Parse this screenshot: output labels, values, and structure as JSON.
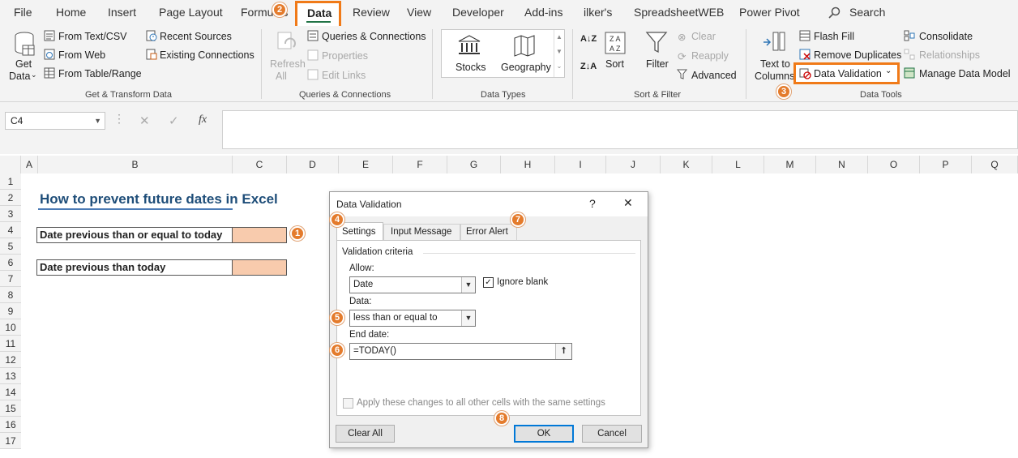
{
  "menu": {
    "tabs": [
      "File",
      "Home",
      "Insert",
      "Page Layout",
      "Formulas",
      "Data",
      "Review",
      "View",
      "Developer",
      "Add-ins",
      "ilker's",
      "SpreadsheetWEB",
      "Power Pivot"
    ],
    "search": "Search"
  },
  "ribbon": {
    "get_data": [
      "Get",
      "Data"
    ],
    "from_text": "From Text/CSV",
    "from_web": "From Web",
    "from_table": "From Table/Range",
    "recent_sources": "Recent Sources",
    "existing_conn": "Existing Connections",
    "group_get": "Get & Transform Data",
    "refresh": [
      "Refresh",
      "All"
    ],
    "queries": "Queries & Connections",
    "properties": "Properties",
    "edit_links": "Edit Links",
    "group_queries": "Queries & Connections",
    "stocks": "Stocks",
    "geography": "Geography",
    "group_types": "Data Types",
    "sort": "Sort",
    "filter": "Filter",
    "clear": "Clear",
    "reapply": "Reapply",
    "advanced": "Advanced",
    "group_sort": "Sort & Filter",
    "text_to_columns": [
      "Text to",
      "Columns"
    ],
    "flash_fill": "Flash Fill",
    "remove_dup": "Remove Duplicates",
    "data_validation": "Data Validation",
    "consolidate": "Consolidate",
    "relationships": "Relationships",
    "manage_model": "Manage Data Model",
    "group_tools": "Data Tools"
  },
  "formula_bar": {
    "name_box": "C4",
    "fx": "fx"
  },
  "columns": [
    "A",
    "B",
    "C",
    "D",
    "E",
    "F",
    "G",
    "H",
    "I",
    "J",
    "K",
    "L",
    "M",
    "N",
    "O",
    "P",
    "Q"
  ],
  "rows": [
    "1",
    "2",
    "3",
    "4",
    "5",
    "6",
    "7",
    "8",
    "9",
    "10",
    "11",
    "12",
    "13",
    "14",
    "15",
    "16",
    "17"
  ],
  "sheet": {
    "title": "How to prevent future dates in Excel",
    "label1": "Date previous than or equal to today",
    "label2": "Date previous than today"
  },
  "dialog": {
    "title": "Data Validation",
    "help": "?",
    "close": "✕",
    "tabs": [
      "Settings",
      "Input Message",
      "Error Alert"
    ],
    "criteria": "Validation criteria",
    "allow_label": "Allow:",
    "allow_value": "Date",
    "ignore_blank": "Ignore blank",
    "data_label": "Data:",
    "data_value": "less than or equal to",
    "end_label": "End date:",
    "end_value": "=TODAY()",
    "apply_all": "Apply these changes to all other cells with the same settings",
    "clear_all": "Clear All",
    "ok": "OK",
    "cancel": "Cancel"
  },
  "callouts": [
    "1",
    "2",
    "3",
    "4",
    "5",
    "6",
    "7",
    "8"
  ],
  "colors": {
    "accent": "#f07a18",
    "callout": "#e47b2c",
    "title": "#1f4e79",
    "cell_fill": "#f8cbad",
    "data_tab_underline": "#217346"
  }
}
